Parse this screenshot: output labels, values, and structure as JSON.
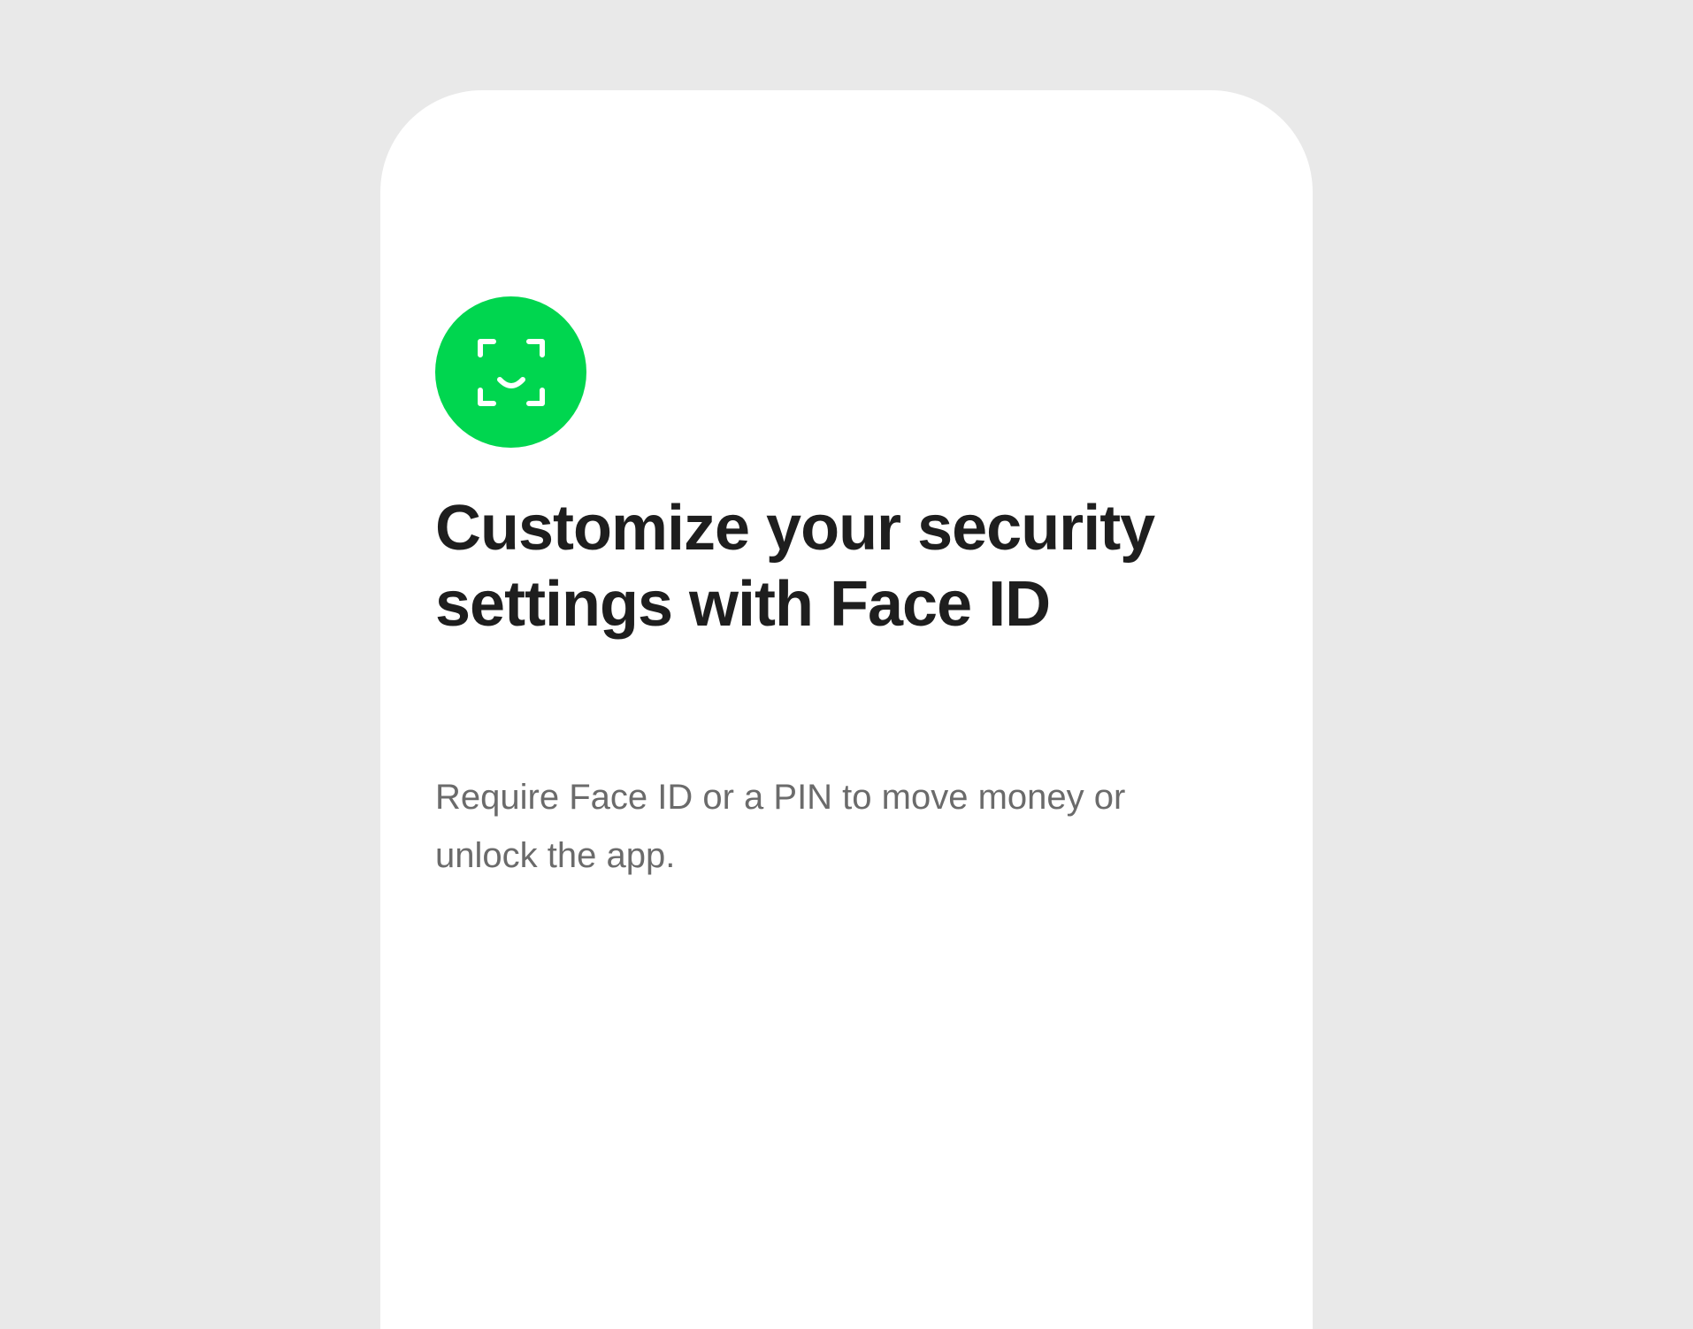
{
  "icon": {
    "name": "face-id-icon",
    "background_color": "#00d64f",
    "glyph_color": "#ffffff"
  },
  "title": "Customize your security settings with Face ID",
  "description": "Require Face ID or a PIN to move money or unlock the app.",
  "colors": {
    "page_background": "#e9e9e9",
    "card_background": "#ffffff",
    "title_text": "#1e1e1e",
    "description_text": "#6b6b6b"
  }
}
